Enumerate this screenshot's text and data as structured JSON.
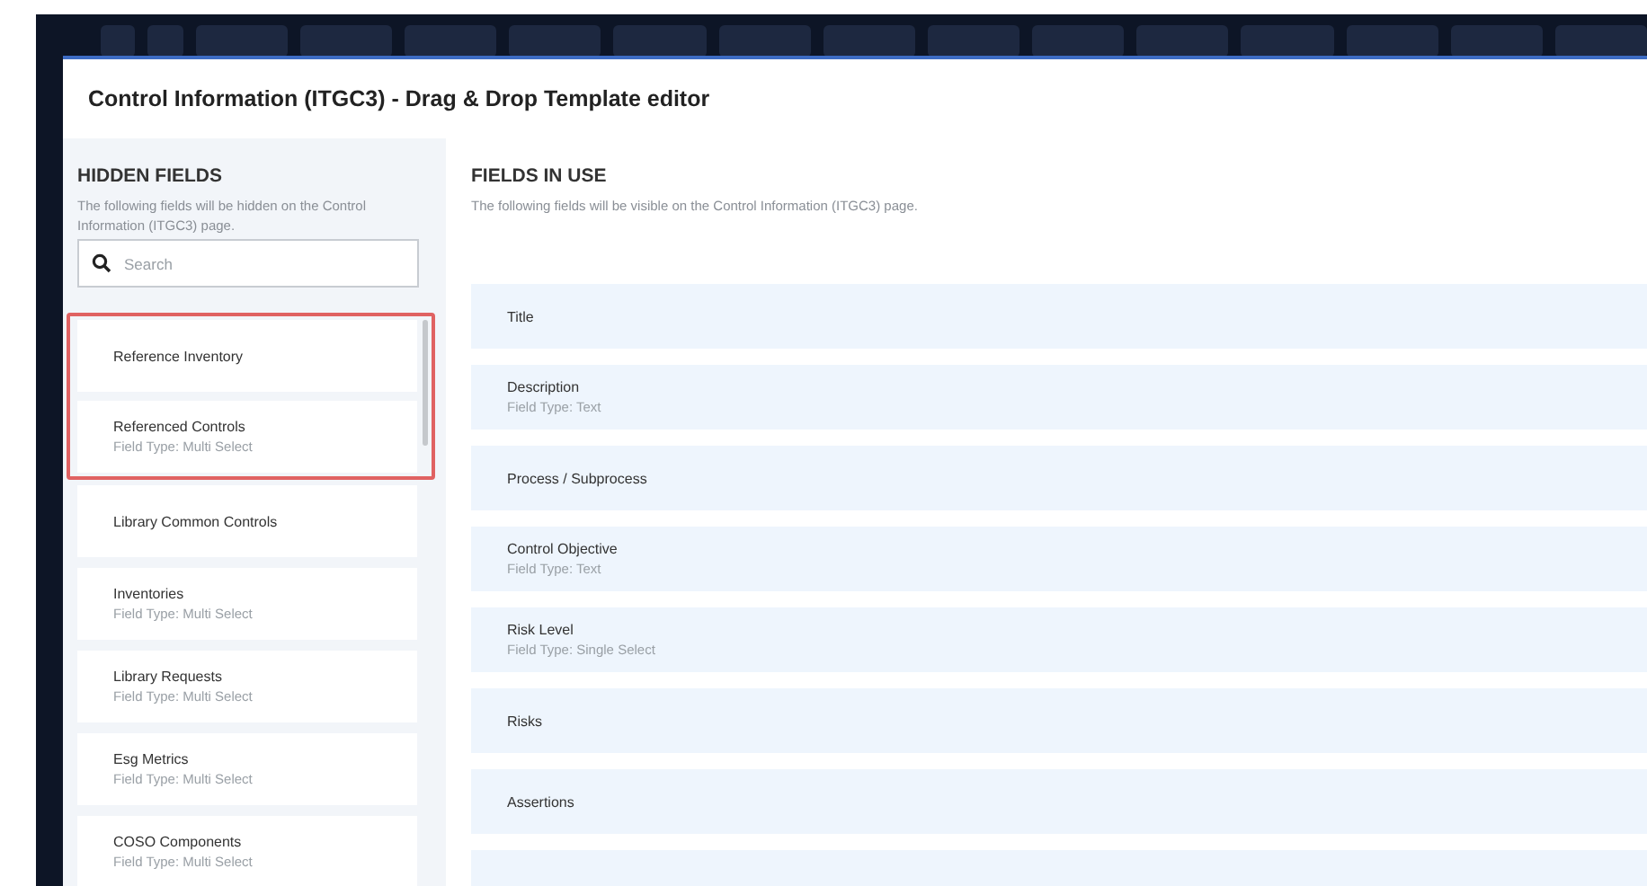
{
  "dialog": {
    "title": "Control Information (ITGC3) - Drag & Drop Template editor"
  },
  "hidden_fields": {
    "heading": "HIDDEN FIELDS",
    "description": "The following fields will be hidden on the Control Information (ITGC3) page.",
    "search": {
      "placeholder": "Search"
    },
    "items": [
      {
        "label": "Reference Inventory",
        "highlighted": true
      },
      {
        "label": "Referenced Controls",
        "field_type": "Field Type: Multi Select",
        "highlighted": true
      },
      {
        "label": "Library Common Controls",
        "highlighted": false
      },
      {
        "label": "Inventories",
        "field_type": "Field Type: Multi Select",
        "highlighted": false
      },
      {
        "label": "Library Requests",
        "field_type": "Field Type: Multi Select",
        "highlighted": false
      },
      {
        "label": "Esg Metrics",
        "field_type": "Field Type: Multi Select",
        "highlighted": false
      },
      {
        "label": "COSO Components",
        "field_type": "Field Type: Multi Select",
        "highlighted": false
      }
    ]
  },
  "fields_in_use": {
    "heading": "FIELDS IN USE",
    "description": "The following fields will be visible on the Control Information (ITGC3) page.",
    "items": [
      {
        "label": "Title"
      },
      {
        "label": "Description",
        "field_type": "Field Type: Text"
      },
      {
        "label": "Process / Subprocess"
      },
      {
        "label": "Control Objective",
        "field_type": "Field Type: Text"
      },
      {
        "label": "Risk Level",
        "field_type": "Field Type: Single Select"
      },
      {
        "label": "Risks"
      },
      {
        "label": "Assertions"
      }
    ]
  }
}
